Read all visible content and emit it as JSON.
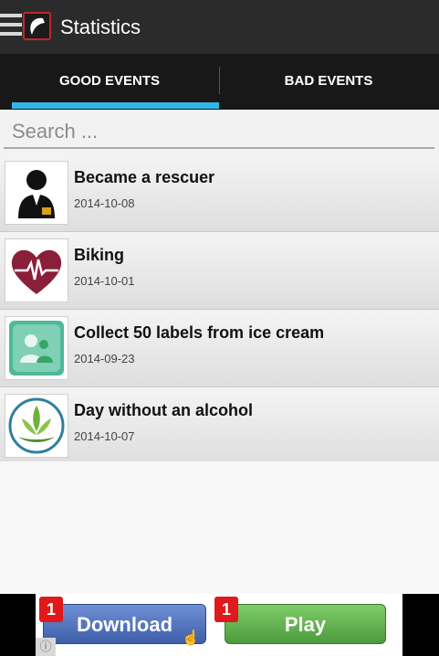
{
  "header": {
    "title": "Statistics"
  },
  "tabs": [
    {
      "label": "GOOD EVENTS",
      "selected": true
    },
    {
      "label": "BAD EVENTS",
      "selected": false
    }
  ],
  "search": {
    "placeholder": "Search ..."
  },
  "events": [
    {
      "title": "Became a rescuer",
      "date": "2014-10-08",
      "icon": "rescuer-icon"
    },
    {
      "title": "Biking",
      "date": "2014-10-01",
      "icon": "heart-pulse-icon"
    },
    {
      "title": "Collect 50 labels from ice cream",
      "date": "2014-09-23",
      "icon": "people-icon"
    },
    {
      "title": "Day without an alcohol",
      "date": "2014-10-07",
      "icon": "leaf-icon"
    }
  ],
  "ad": {
    "download_label": "Download",
    "play_label": "Play",
    "badge_1": "1",
    "badge_2": "1"
  },
  "colors": {
    "tab_indicator": "#33b5e5",
    "actionbar": "#2b2b2b"
  }
}
